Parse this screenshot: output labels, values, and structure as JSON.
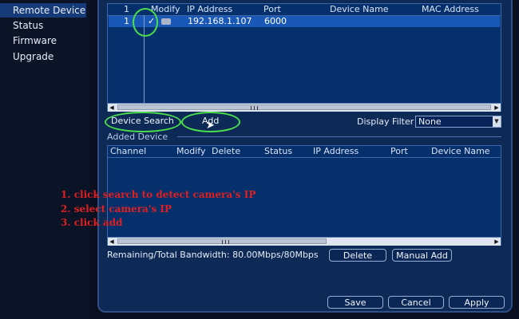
{
  "nav": {
    "items": [
      "Remote Device",
      "Status",
      "Firmware",
      "Upgrade"
    ],
    "selected": "Remote Device"
  },
  "search_table": {
    "headers": [
      "1",
      "Modify",
      "IP Address",
      "Port",
      "Device Name",
      "MAC Address"
    ],
    "rows": [
      {
        "index": "1",
        "checked": "✓",
        "ip": "192.168.1.107",
        "port": "6000"
      }
    ]
  },
  "search_controls": {
    "device_search_label": "Device Search",
    "add_label": "Add",
    "display_filter_label": "Display Filter",
    "display_filter_value": "None"
  },
  "added": {
    "section_label": "Added Device",
    "headers": [
      "Channel",
      "Modify",
      "Delete",
      "Status",
      "IP Address",
      "Port",
      "Device Name"
    ]
  },
  "bandwidth_text": "Remaining/Total Bandwidth: 80.00Mbps/80Mbps",
  "actions": {
    "delete_label": "Delete",
    "manual_add_label": "Manual Add",
    "save_label": "Save",
    "cancel_label": "Cancel",
    "apply_label": "Apply"
  },
  "annotations": [
    "1. click search to detect camera's IP",
    "2. select camera's IP",
    "3. click add"
  ],
  "colors": {
    "panel": "#0d2a57",
    "table": "#06306c",
    "selected_row": "#1a58b8",
    "annotation_green": "#4cdf4c",
    "annotation_red": "#e02020"
  }
}
